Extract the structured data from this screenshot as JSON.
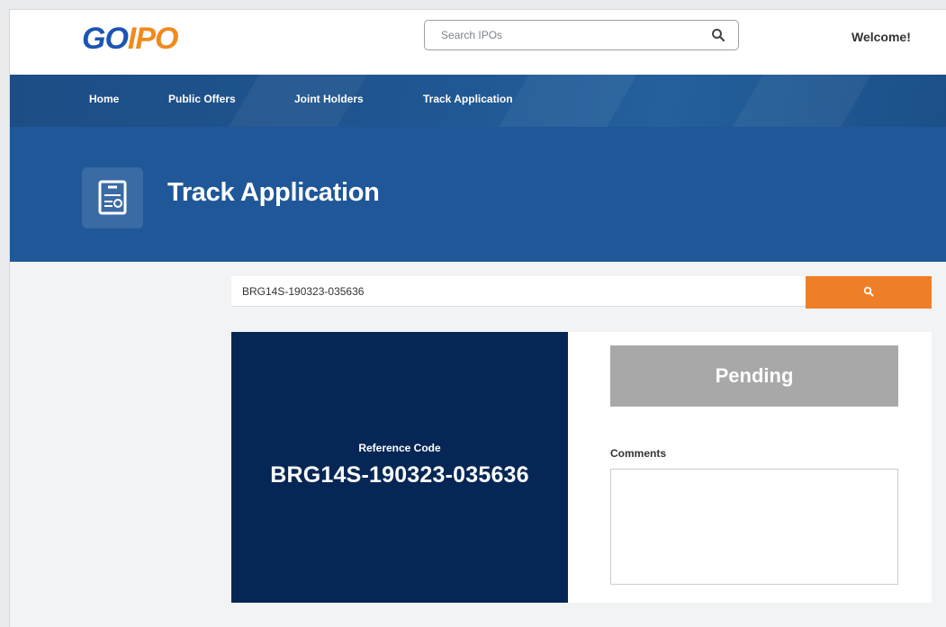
{
  "header": {
    "logo_part1": "GO",
    "logo_part2": "IPO",
    "search_placeholder": "Search IPOs",
    "search_icon": "search-icon",
    "welcome_text": "Welcome!"
  },
  "nav": {
    "items": [
      {
        "label": "Home"
      },
      {
        "label": "Public Offers"
      },
      {
        "label": "Joint Holders"
      },
      {
        "label": "Track Application"
      }
    ]
  },
  "hero": {
    "icon": "application-card-icon",
    "title": "Track Application"
  },
  "tracker": {
    "input_value": "BRG14S-190323-035636",
    "search_button_icon": "search-icon"
  },
  "reference": {
    "label": "Reference Code",
    "code": "BRG14S-190323-035636"
  },
  "status": {
    "label": "Pending",
    "comments_label": "Comments",
    "comments_value": ""
  },
  "colors": {
    "brand_blue": "#1a56b3",
    "brand_orange": "#f08a1c",
    "nav_blue": "#1f5590",
    "hero_blue": "#1f5798",
    "card_navy": "#062755",
    "search_button": "#ee7f28",
    "pending_gray": "#a8a8a8"
  }
}
